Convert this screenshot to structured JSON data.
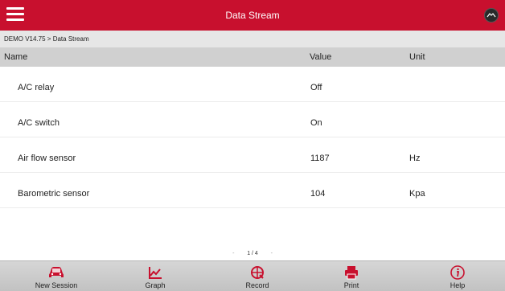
{
  "header": {
    "title": "Data Stream",
    "menu_icon": "hamburger-menu-icon",
    "vci_icon": "vci-connector-icon",
    "accent_color": "#c8102e"
  },
  "breadcrumb": "DEMO V14.75 > Data Stream",
  "columns": {
    "name": "Name",
    "value": "Value",
    "unit": "Unit"
  },
  "rows": [
    {
      "name": "A/C relay",
      "value": "Off",
      "unit": ""
    },
    {
      "name": "A/C switch",
      "value": "On",
      "unit": ""
    },
    {
      "name": "Air flow sensor",
      "value": "1187",
      "unit": "Hz"
    },
    {
      "name": "Barometric sensor",
      "value": "104",
      "unit": "Kpa"
    }
  ],
  "pager": {
    "text": "1 / 4",
    "prev": "-",
    "next": "-"
  },
  "toolbar": {
    "new_session": "New Session",
    "graph": "Graph",
    "record": "Record",
    "print": "Print",
    "help": "Help"
  }
}
